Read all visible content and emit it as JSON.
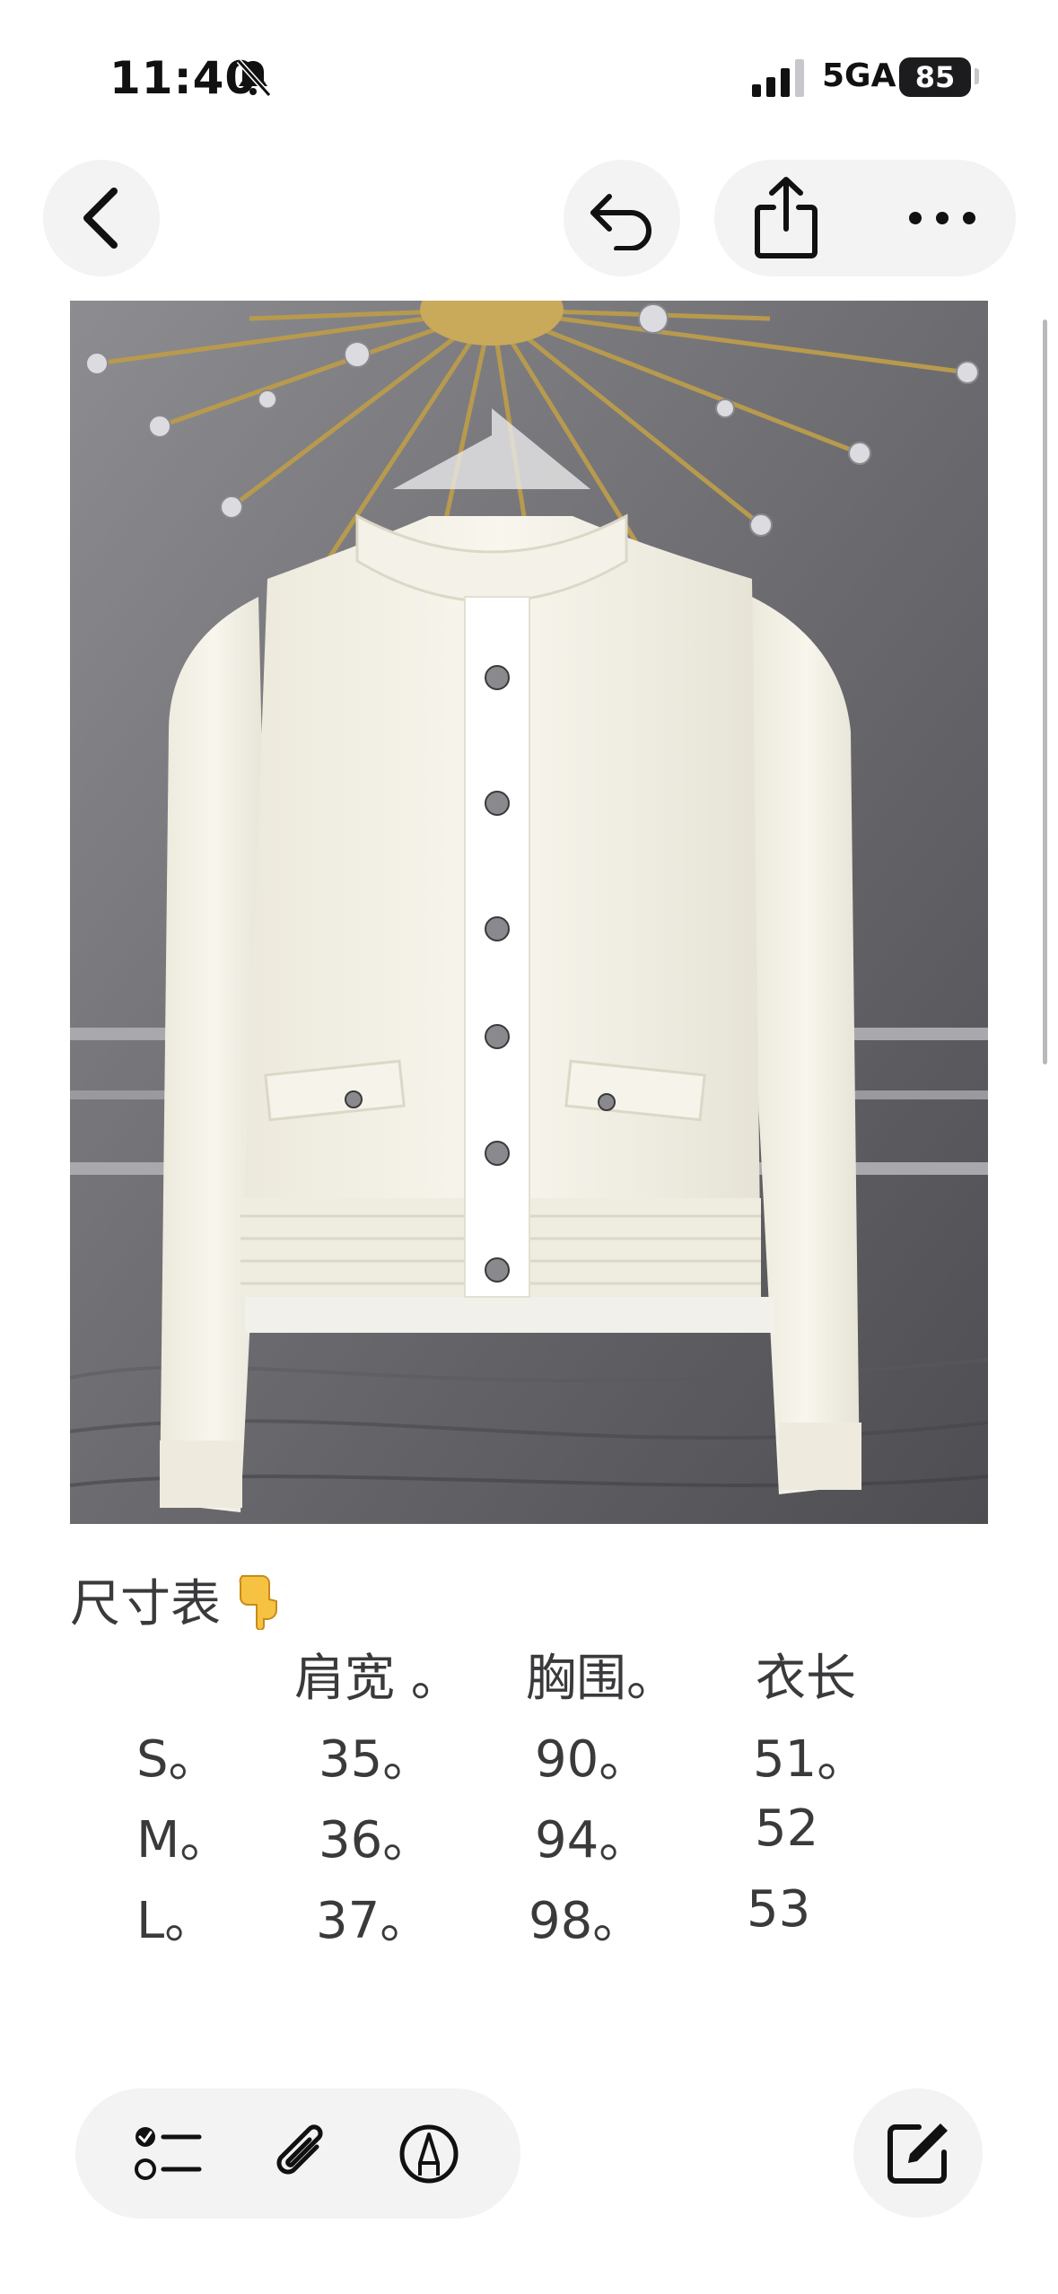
{
  "status_bar": {
    "time": "11:40",
    "network": "5GA",
    "battery": "85"
  },
  "nav": {
    "back_icon": "chevron-left-icon",
    "undo_icon": "undo-icon",
    "share_icon": "share-icon",
    "more_icon": "more-icon"
  },
  "note": {
    "image_alt": "white knit cardigan photo",
    "heading": "尺寸表",
    "heading_emoji": "pointing-down-emoji",
    "table": {
      "headers": [
        "肩宽 。",
        "胸围。",
        "衣长"
      ],
      "rows": [
        {
          "size": "S。",
          "shoulder": "35。",
          "chest": "90。",
          "length": "51。"
        },
        {
          "size": "M。",
          "shoulder": "36。",
          "chest": "94。",
          "length": "52"
        },
        {
          "size": "L。",
          "shoulder": "37。",
          "chest": "98。",
          "length": "53"
        }
      ]
    }
  },
  "toolbar": {
    "checklist_icon": "checklist-icon",
    "attach_icon": "paperclip-icon",
    "markup_icon": "markup-pen-icon",
    "compose_icon": "compose-icon"
  }
}
